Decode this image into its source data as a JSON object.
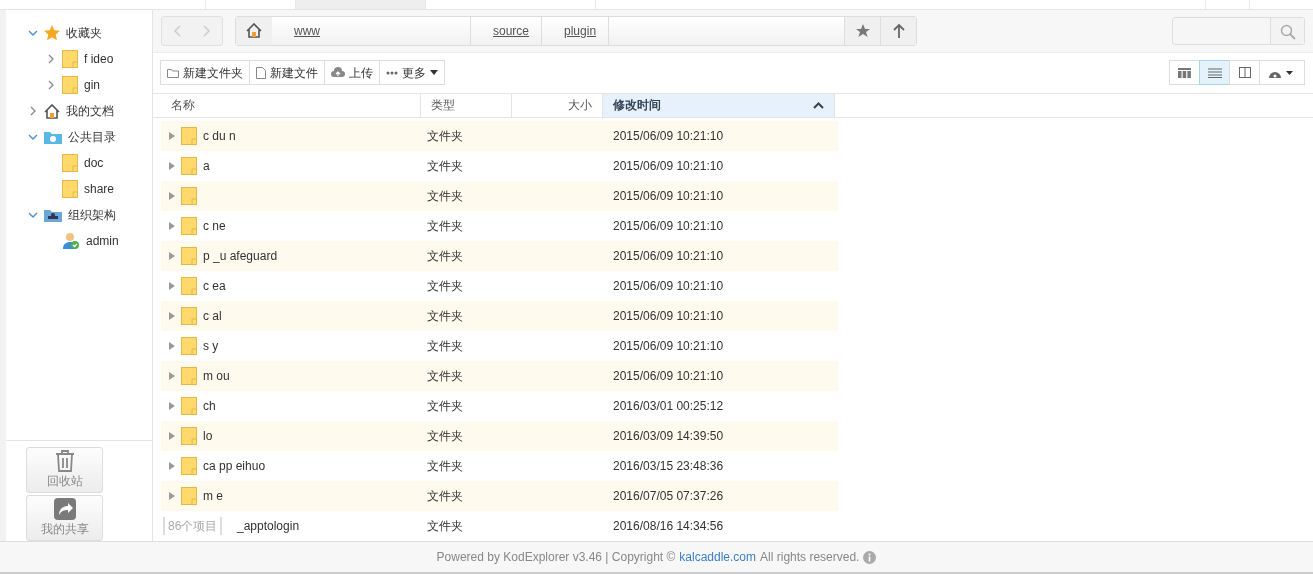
{
  "sidebar": {
    "tree": [
      {
        "label": "收藏夹",
        "expanded": true,
        "children": [
          {
            "label": "f ideo",
            "expanded": false
          },
          {
            "label": "gin",
            "expanded": false
          }
        ]
      },
      {
        "label": "我的文档",
        "expanded": false
      },
      {
        "label": "公共目录",
        "expanded": true,
        "children": [
          {
            "label": "doc"
          },
          {
            "label": "share"
          }
        ]
      },
      {
        "label": "组织架构",
        "expanded": true,
        "children": [
          {
            "label": "admin"
          }
        ]
      }
    ],
    "bottom_buttons": [
      "回收站",
      "我的共享"
    ]
  },
  "path_bar": {
    "crumbs": [
      "www",
      "source",
      "plugin"
    ]
  },
  "toolbar": {
    "buttons": [
      "新建文件夹",
      "新建文件",
      "上传",
      "更多"
    ],
    "views": [
      {
        "selected": false
      },
      {
        "selected": true
      },
      {
        "selected": false
      },
      {
        "selected": false
      }
    ]
  },
  "table": {
    "columns": [
      {
        "label": "名称",
        "sorted": false
      },
      {
        "label": "类型",
        "sorted": false
      },
      {
        "label": "大小",
        "sorted": false
      },
      {
        "label": "修改时间",
        "sorted": true
      }
    ],
    "rows": [
      {
        "name": "c du n",
        "type": "文件夹",
        "modified": "2015/06/09 10:21:10"
      },
      {
        "name": "a",
        "type": "文件夹",
        "modified": "2015/06/09 10:21:10"
      },
      {
        "type": "文件夹",
        "modified": "2015/06/09 10:21:10"
      },
      {
        "name": "c ne",
        "type": "文件夹",
        "modified": "2015/06/09 10:21:10"
      },
      {
        "name": "p _u afeguard",
        "type": "文件夹",
        "modified": "2015/06/09 10:21:10"
      },
      {
        "name": "c ea",
        "type": "文件夹",
        "modified": "2015/06/09 10:21:10"
      },
      {
        "name": "c al",
        "type": "文件夹",
        "modified": "2015/06/09 10:21:10"
      },
      {
        "name": "s y",
        "type": "文件夹",
        "modified": "2015/06/09 10:21:10"
      },
      {
        "name": "m ou",
        "type": "文件夹",
        "modified": "2015/06/09 10:21:10"
      },
      {
        "name": "ch",
        "type": "文件夹",
        "modified": "2016/03/01 00:25:12"
      },
      {
        "name": "lo",
        "type": "文件夹",
        "modified": "2016/03/09 14:39:50"
      },
      {
        "name": "ca pp eihuo",
        "type": "文件夹",
        "modified": "2016/03/15 23:48:36"
      },
      {
        "name": "m e",
        "type": "文件夹",
        "modified": "2016/07/05 07:37:26"
      },
      {
        "name": "_apptologin",
        "type": "文件夹",
        "modified": "2016/08/16 14:34:56"
      }
    ],
    "item_count": "86个项目"
  },
  "footer": {
    "text": "Powered by KodExplorer v3.46 | Copyright ©",
    "link": "kalcaddle.com",
    "suffix": "All rights reserved."
  }
}
